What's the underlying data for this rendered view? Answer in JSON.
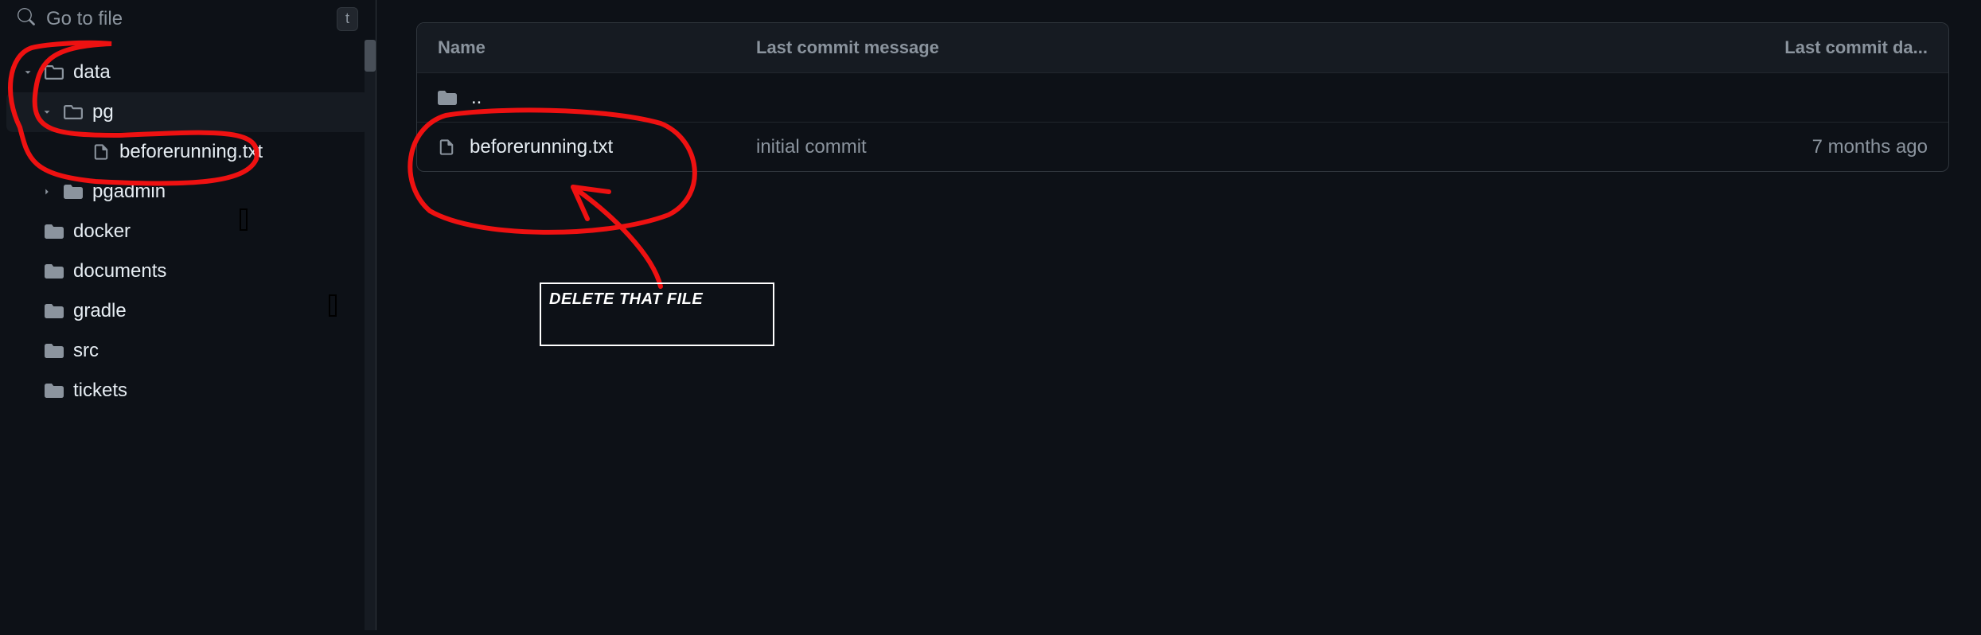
{
  "search": {
    "placeholder": "Go to file",
    "shortcut": "t"
  },
  "tree": [
    {
      "label": "data",
      "kind": "folder-open",
      "chev": "down",
      "depth": 0,
      "selected": false
    },
    {
      "label": "pg",
      "kind": "folder-open",
      "chev": "down",
      "depth": 1,
      "selected": true
    },
    {
      "label": "beforerunning.txt",
      "kind": "file",
      "chev": "none",
      "depth": 2,
      "selected": false
    },
    {
      "label": "pgadmin",
      "kind": "folder",
      "chev": "right",
      "depth": 1,
      "selected": false
    },
    {
      "label": "docker",
      "kind": "folder",
      "chev": "none",
      "depth": 0,
      "selected": false
    },
    {
      "label": "documents",
      "kind": "folder",
      "chev": "none",
      "depth": 0,
      "selected": false
    },
    {
      "label": "gradle",
      "kind": "folder",
      "chev": "none",
      "depth": 0,
      "selected": false
    },
    {
      "label": "src",
      "kind": "folder",
      "chev": "none",
      "depth": 0,
      "selected": false
    },
    {
      "label": "tickets",
      "kind": "folder",
      "chev": "none",
      "depth": 0,
      "selected": false
    }
  ],
  "table": {
    "headers": {
      "name": "Name",
      "message": "Last commit message",
      "date": "Last commit da..."
    },
    "up_label": "..",
    "rows": [
      {
        "name": "beforerunning.txt",
        "message": "initial commit",
        "date": "7 months ago"
      }
    ]
  },
  "annotation": {
    "text": "DELETE THAT FILE",
    "color": "#e11"
  }
}
